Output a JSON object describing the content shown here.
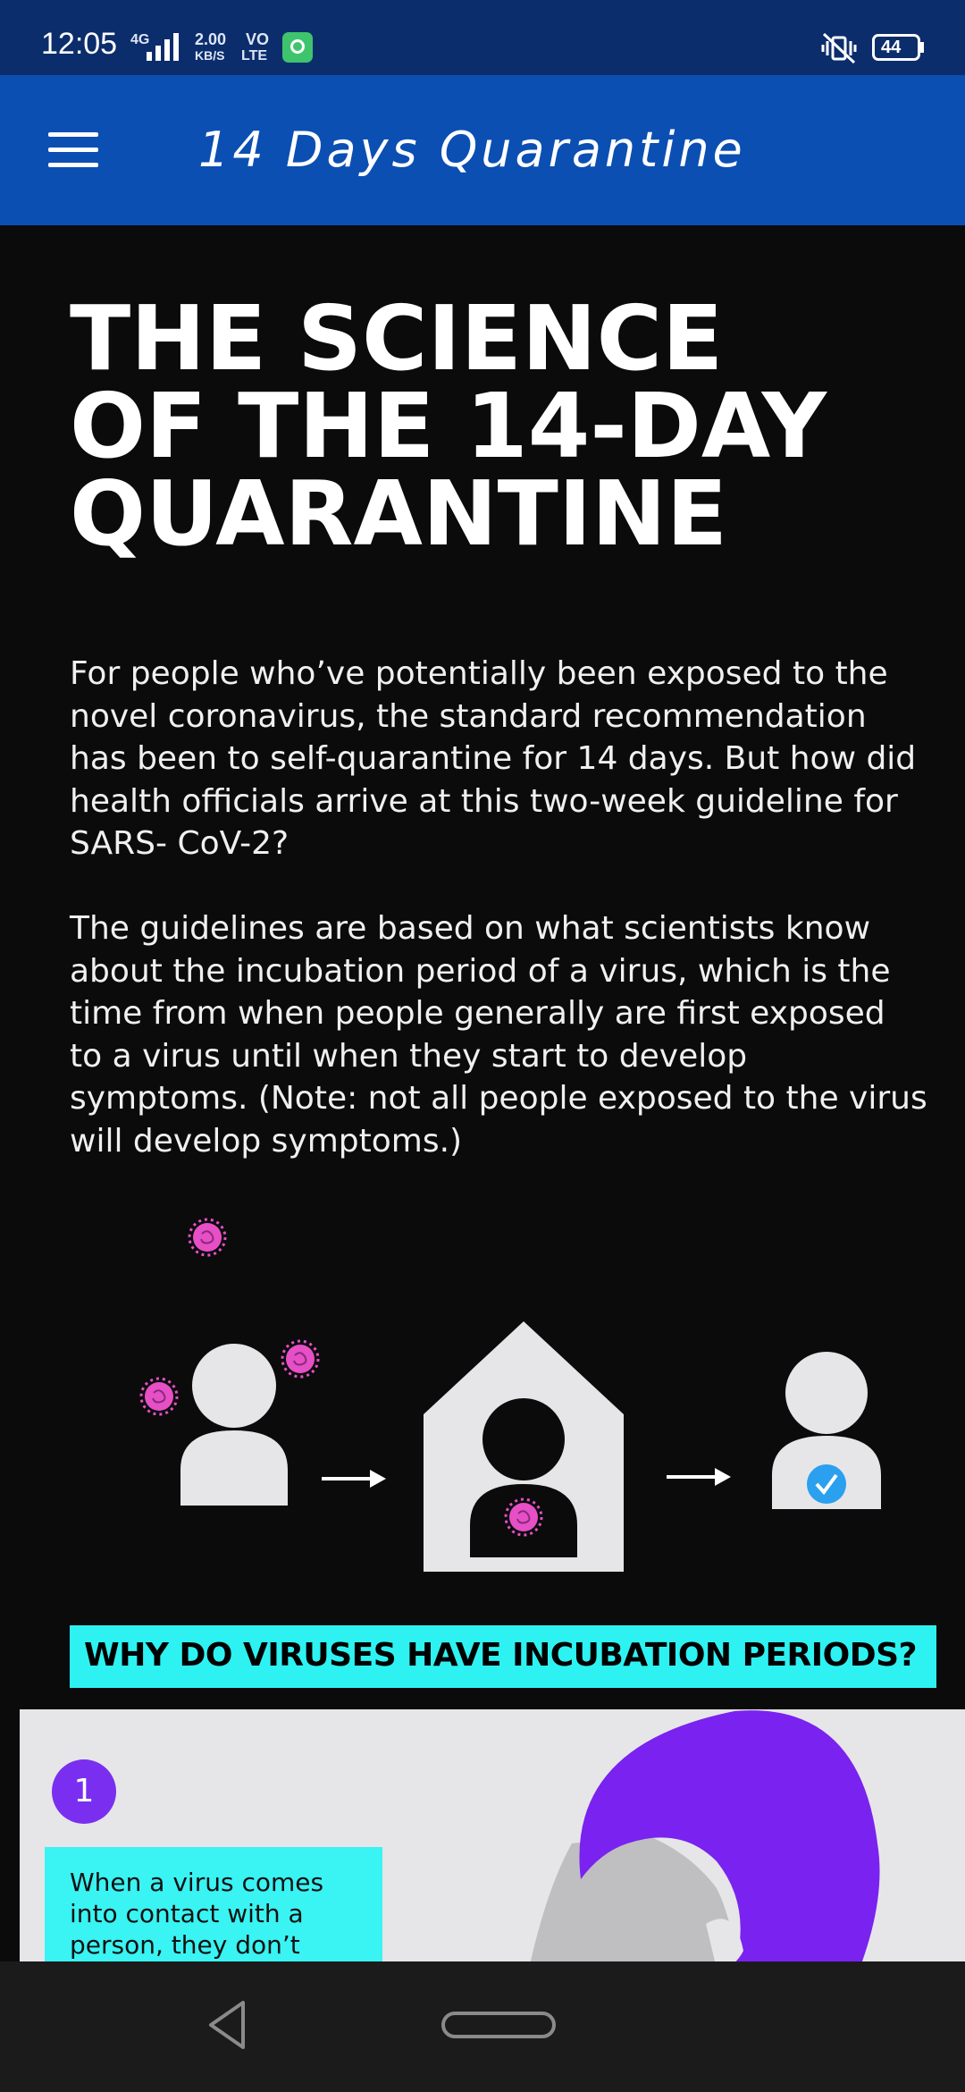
{
  "status_bar": {
    "time": "12:05",
    "network": "4G",
    "speed_value": "2.00",
    "speed_unit": "KB/S",
    "volte_top": "VO",
    "volte_bottom": "LTE",
    "battery": "44"
  },
  "app_bar": {
    "title": "14 Days Quarantine"
  },
  "article": {
    "headline": "THE SCIENCE OF THE 14-DAY QUARANTINE",
    "paragraphs": [
      "For people who’ve potentially been exposed to the novel coronavirus, the standard recommendation has been to self-quarantine for 14 days. But how did health officials arrive at this two-week guideline for SARS- CoV-2?",
      "The guidelines are based on what scientists know about the incubation period of a virus, which is the time from when people generally are first exposed to a virus until when they start to develop symptoms. (Note: not all people exposed to the virus will develop symptoms.)"
    ],
    "section_banner": "WHY DO VIRUSES HAVE INCUBATION PERIODS?",
    "step": {
      "number": "1",
      "text": "When a virus comes into contact with a person, they don’t become sick"
    }
  },
  "colors": {
    "status_bar": "#0c2d6b",
    "app_bar": "#0b4fb3",
    "background": "#0b0b0c",
    "virus": "#e64fc6",
    "banner": "#2ef2f2",
    "step_circle": "#7a2ff0",
    "check": "#2aa0ef"
  },
  "icons": {
    "menu": "menu-icon",
    "back": "back-icon",
    "home": "home-icon"
  }
}
